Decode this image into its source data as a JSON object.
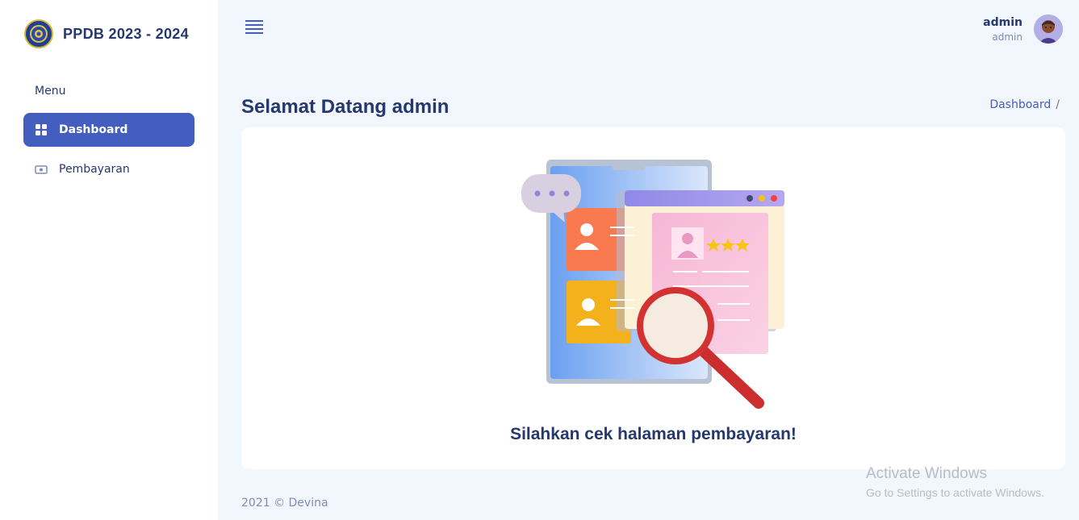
{
  "sidebar": {
    "brand_title": "PPDB 2023 - 2024",
    "menu_title": "Menu",
    "items": [
      {
        "label": "Dashboard",
        "icon": "grid-icon",
        "active": true
      },
      {
        "label": "Pembayaran",
        "icon": "cash-icon",
        "active": false
      }
    ]
  },
  "header": {
    "user_name": "admin",
    "user_role": "admin"
  },
  "page": {
    "title": "Selamat Datang admin",
    "breadcrumb": [
      "Dashboard",
      "/"
    ]
  },
  "card": {
    "message": "Silahkan cek halaman pembayaran!"
  },
  "footer": {
    "text": "2021 © Devina"
  },
  "watermark": {
    "line1": "Activate Windows",
    "line2": "Go to Settings to activate Windows."
  },
  "colors": {
    "primary": "#435ebe",
    "text": "#25396f",
    "background": "#f2f6fd"
  }
}
